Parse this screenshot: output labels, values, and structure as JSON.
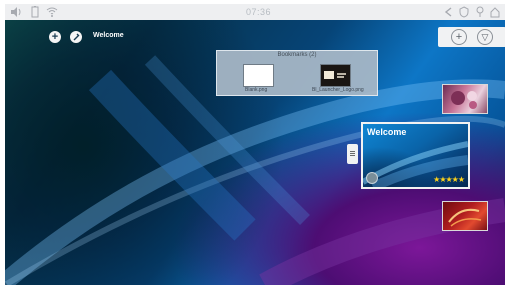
{
  "status_bar": {
    "clock": "07:36",
    "left_icons": [
      "volume-icon",
      "battery-icon",
      "wifi-icon"
    ],
    "right_icons": [
      "back-icon",
      "shield-icon",
      "location-icon",
      "home-icon"
    ]
  },
  "home": {
    "current_screen_label": "Welcome"
  },
  "bookmarks": {
    "title": "Bookmarks (2)",
    "items": [
      {
        "caption": "Blank.png"
      },
      {
        "caption": "Bl_Launcher_Logo.png"
      }
    ]
  },
  "toolbar": {
    "add_label": "+",
    "filter_label": "▽"
  },
  "welcome_card": {
    "title": "Welcome",
    "stars": "★★★★★",
    "rating": 5
  },
  "colors": {
    "statusbar_bg": "#eeeff1",
    "wallpaper_blue": "#0d76c6",
    "wallpaper_purple": "#7c1799",
    "star": "#ffd31a"
  }
}
